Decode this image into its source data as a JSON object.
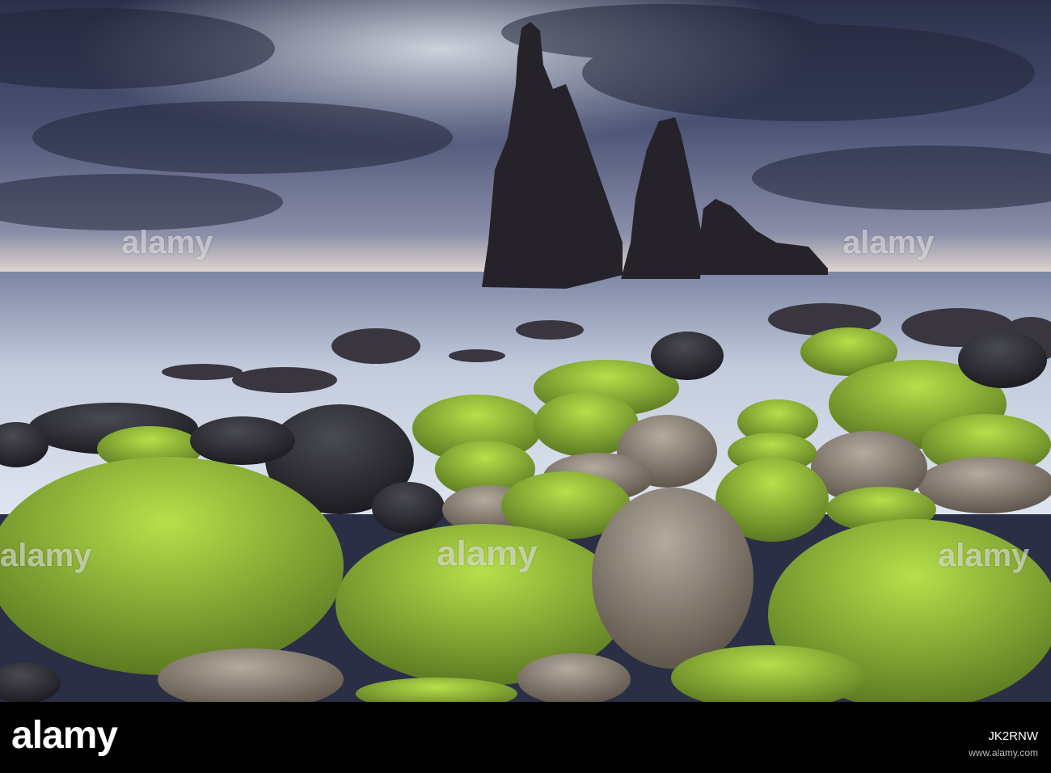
{
  "watermark": {
    "text": "alamy"
  },
  "footer": {
    "logo": "alamy",
    "image_id": "JK2RNW",
    "sub": "www.alamy.com"
  },
  "colors": {
    "sky": "#3a4260",
    "sea": "#c9d1e2",
    "rock": "#2a2628",
    "moss": "#9ac83a",
    "boulder": "#8f8578"
  }
}
